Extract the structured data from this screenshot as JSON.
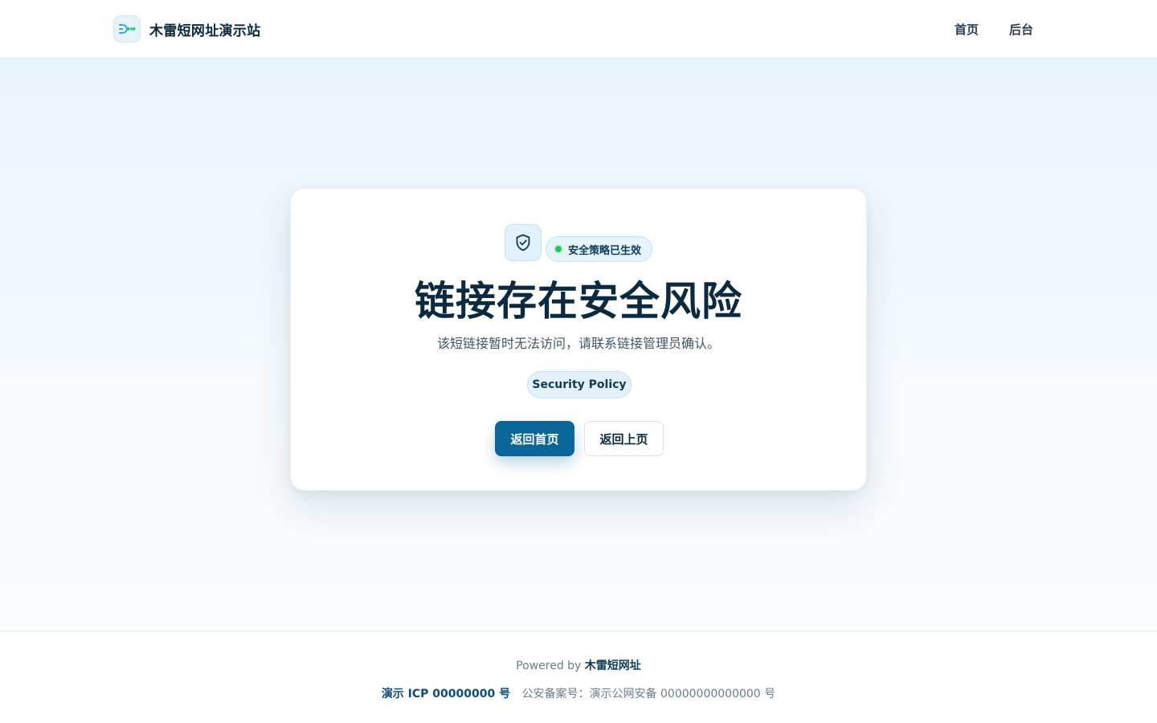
{
  "header": {
    "brand_name": "木雷短网址演示站",
    "logo_icon": "share-arrows-icon",
    "nav": [
      {
        "label": "首页"
      },
      {
        "label": "后台"
      }
    ]
  },
  "card": {
    "shield_icon": "shield-check-icon",
    "status_label": "安全策略已生效",
    "status_color": "#22c55e",
    "title": "链接存在安全风险",
    "subtitle": "该短链接暂时无法访问，请联系链接管理员确认。",
    "policy_tag": "Security Policy",
    "primary_button": "返回首页",
    "secondary_button": "返回上页"
  },
  "footer": {
    "powered_prefix": "Powered by",
    "powered_brand": "木雷短网址",
    "icp": "演示 ICP 00000000 号",
    "police_record": "公安备案号：演示公网安备 00000000000000 号"
  },
  "colors": {
    "primary": "#0a6599",
    "text_dark": "#0b2a3f",
    "accent_bg": "#e2f1fb"
  }
}
